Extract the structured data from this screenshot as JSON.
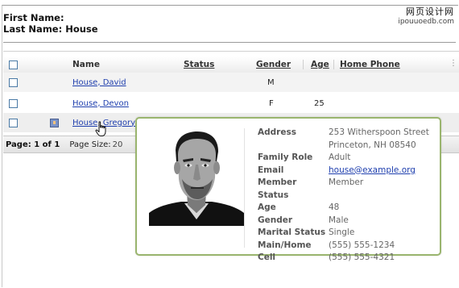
{
  "header": {
    "first_name_label": "First Name:",
    "first_name_value": "",
    "last_name_label": "Last Name:",
    "last_name_value": "House"
  },
  "watermark": {
    "title": "网页设计网",
    "url": "ipouuoedb.com"
  },
  "grid": {
    "columns": [
      "Name",
      "Status",
      "Gender",
      "Age",
      "Home Phone"
    ],
    "rows": [
      {
        "name": "House, David",
        "status": "",
        "gender": "M",
        "age": "",
        "home_phone": ""
      },
      {
        "name": "House, Devon",
        "status": "",
        "gender": "F",
        "age": "25",
        "home_phone": ""
      },
      {
        "name": "House, Gregory",
        "status": "",
        "gender": "",
        "age": "",
        "home_phone": ""
      }
    ]
  },
  "pager": {
    "page_text": "Page: 1 of 1",
    "page_size_label": "Page Size:",
    "page_size_value": "20"
  },
  "popup": {
    "details": [
      {
        "label": "Address",
        "value": "253 Witherspoon Street",
        "value2": "Princeton, NH 08540"
      },
      {
        "label": "Family Role",
        "value": "Adult"
      },
      {
        "label": "Email",
        "value": "house@example.org"
      },
      {
        "label": "Member Status",
        "value": "Member"
      },
      {
        "label": "Age",
        "value": "48"
      },
      {
        "label": "Gender",
        "value": "Male"
      },
      {
        "label": "Marital Status",
        "value": "Single"
      },
      {
        "label": "Main/Home",
        "value": "(555) 555-1234"
      },
      {
        "label": "Cell",
        "value": "(555) 555-4321"
      }
    ]
  },
  "colors": {
    "link": "#1f3fae",
    "popup_border": "#9ab56e",
    "checkbox_border": "#4a7aa6"
  },
  "icons": [
    "person-card-icon",
    "hand-cursor-icon",
    "portrait-photo"
  ]
}
